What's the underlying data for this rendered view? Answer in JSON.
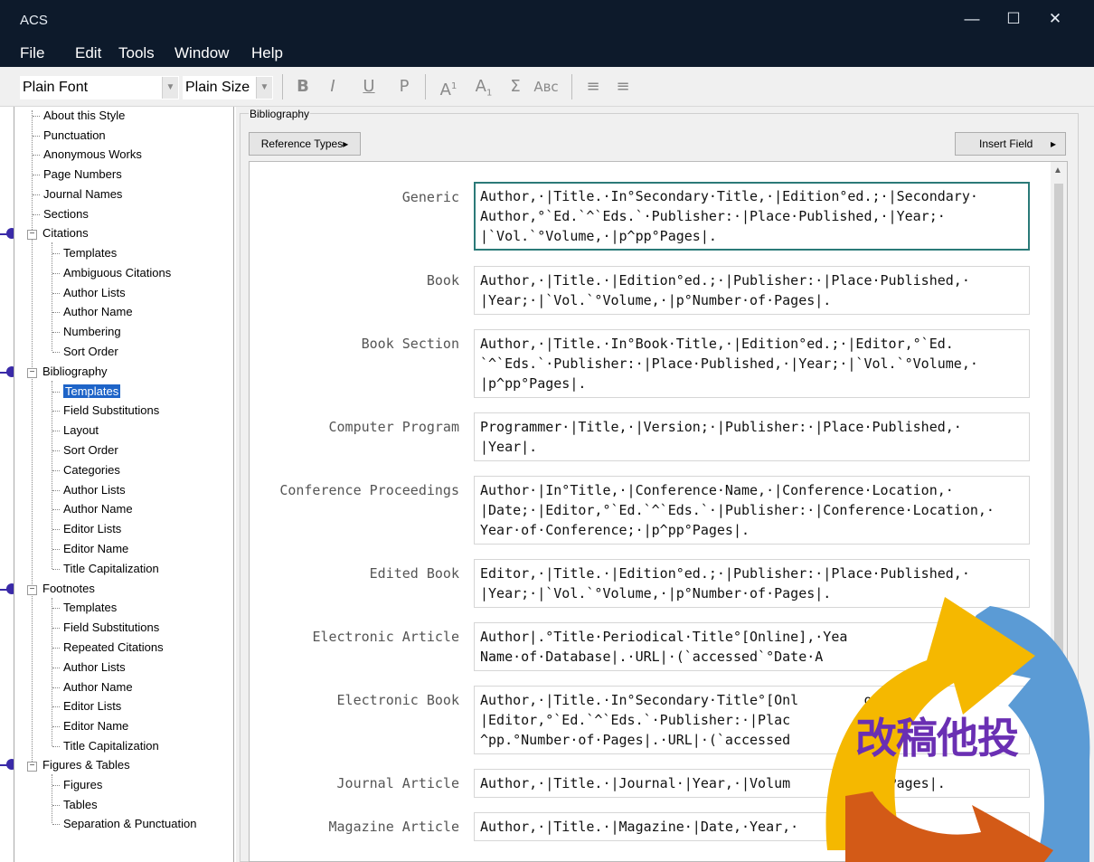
{
  "window": {
    "title": "ACS",
    "controls": {
      "minimize": "—",
      "maximize": "☐",
      "close": "✕"
    }
  },
  "menu": [
    "File",
    "Edit",
    "Tools",
    "Window",
    "Help"
  ],
  "toolbar": {
    "font": "Plain Font",
    "size": "Plain Size",
    "bold": "B",
    "italic": "I",
    "underline": "U",
    "plain": "P",
    "superscript": "A",
    "superscript_mark": "1",
    "subscript": "A",
    "subscript_mark": "1",
    "symbol": "Σ",
    "smallcaps": "Aʙᴄ",
    "align_left": "≡",
    "align_justify": "≡"
  },
  "tree": {
    "items": [
      "About this Style",
      "Punctuation",
      "Anonymous Works",
      "Page Numbers",
      "Journal Names",
      "Sections",
      "Citations",
      "Templates",
      "Ambiguous Citations",
      "Author Lists",
      "Author Name",
      "Numbering",
      "Sort Order",
      "Bibliography",
      "Templates",
      "Field Substitutions",
      "Layout",
      "Sort Order",
      "Categories",
      "Author Lists",
      "Author Name",
      "Editor Lists",
      "Editor Name",
      "Title Capitalization",
      "Footnotes",
      "Templates",
      "Field Substitutions",
      "Repeated Citations",
      "Author Lists",
      "Author Name",
      "Editor Lists",
      "Editor Name",
      "Title Capitalization",
      "Figures & Tables",
      "Figures",
      "Tables",
      "Separation & Punctuation"
    ],
    "selected": "Templates"
  },
  "panel": {
    "group_label": "Bibliography",
    "reference_types_button": "Reference Types▸",
    "insert_field_button": "Insert Field",
    "insert_field_arrow": "▸"
  },
  "templates": [
    {
      "type": "Generic",
      "text": "Author,·|Title.·In°Secondary·Title,·|Edition°ed.;·|Secondary·\nAuthor,°`Ed.`^`Eds.`·Publisher:·|Place·Published,·|Year;·\n|`Vol.`°Volume,·|p^pp°Pages|."
    },
    {
      "type": "Book",
      "text": "Author,·|Title.·|Edition°ed.;·|Publisher:·|Place·Published,·\n|Year;·|`Vol.`°Volume,·|p°Number·of·Pages|."
    },
    {
      "type": "Book Section",
      "text": "Author,·|Title.·In°Book·Title,·|Edition°ed.;·|Editor,°`Ed.\n`^`Eds.`·Publisher:·|Place·Published,·|Year;·|`Vol.`°Volume,·\n|p^pp°Pages|."
    },
    {
      "type": "Computer Program",
      "text": "Programmer·|Title,·|Version;·|Publisher:·|Place·Published,·\n|Year|."
    },
    {
      "type": "Conference Proceedings",
      "text": "Author·|In°Title,·|Conference·Name,·|Conference·Location,·\n|Date;·|Editor,°`Ed.`^`Eds.`·|Publisher:·|Conference·Location,·\nYear·of·Conference;·|p^pp°Pages|."
    },
    {
      "type": "Edited Book",
      "text": "Editor,·|Title.·|Edition°ed.;·|Publisher:·|Place·Published,·\n|Year;·|`Vol.`°Volume,·|p°Number·of·Pages|."
    },
    {
      "type": "Electronic Article",
      "text": "Author|.°Title·Periodical·Title°[Online],·Yea\nName·of·Database|.·URL|·(`accessed`°Date·A"
    },
    {
      "type": "Electronic Book",
      "text": "Author,·|Title.·In°Secondary·Title°[Onl        on°e  .;\n|Editor,°`Ed.`^`Eds.`·Publisher:·|Plac\n^pp.°Number·of·Pages|.·URL|·(`accessed"
    },
    {
      "type": "Journal Article",
      "text": "Author,·|Title.·|Journal·|Year,·|Volum        )|,·Pages|."
    },
    {
      "type": "Magazine Article",
      "text": "Author,·|Title.·|Magazine·|Date,·Year,·"
    }
  ],
  "overlay": {
    "text": "改稿他投",
    "colors": {
      "blue": "#5b9bd5",
      "yellow": "#f5b800",
      "orange": "#d35a17",
      "purple": "#6a2fb3"
    }
  }
}
